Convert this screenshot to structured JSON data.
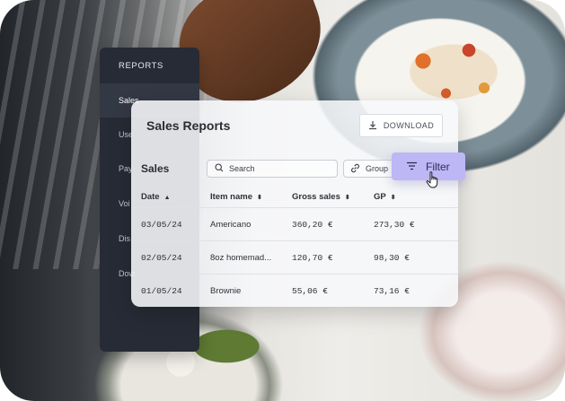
{
  "sidebar": {
    "brand": "REPORTS",
    "items": [
      {
        "label": "Sales"
      },
      {
        "label": "Use"
      },
      {
        "label": "Pay"
      },
      {
        "label": "Voi"
      },
      {
        "label": "Dis"
      },
      {
        "label": "Dow"
      }
    ]
  },
  "card": {
    "title": "Sales Reports",
    "download_label": "DOWNLOAD",
    "section_title": "Sales",
    "search_placeholder": "Search",
    "group_label": "Group",
    "filter_label": "Filter"
  },
  "table": {
    "headers": [
      "Date",
      "Item name",
      "Gross sales",
      "GP"
    ],
    "rows": [
      [
        "03/05/24",
        "Americano",
        "360,20 €",
        "273,30 €"
      ],
      [
        "02/05/24",
        "8oz homemad...",
        "120,70 €",
        "98,30 €"
      ],
      [
        "01/05/24",
        "Brownie",
        "55,06 €",
        "73,16 €"
      ]
    ]
  },
  "icons": {
    "download": "download-icon",
    "search": "search-icon",
    "group": "link-icon",
    "filter": "filter-icon",
    "sort": "sort-icon",
    "cursor": "hand-cursor-icon"
  },
  "colors": {
    "sidebar_bg": "#272b35",
    "filter_accent": "#bdb7f5"
  }
}
